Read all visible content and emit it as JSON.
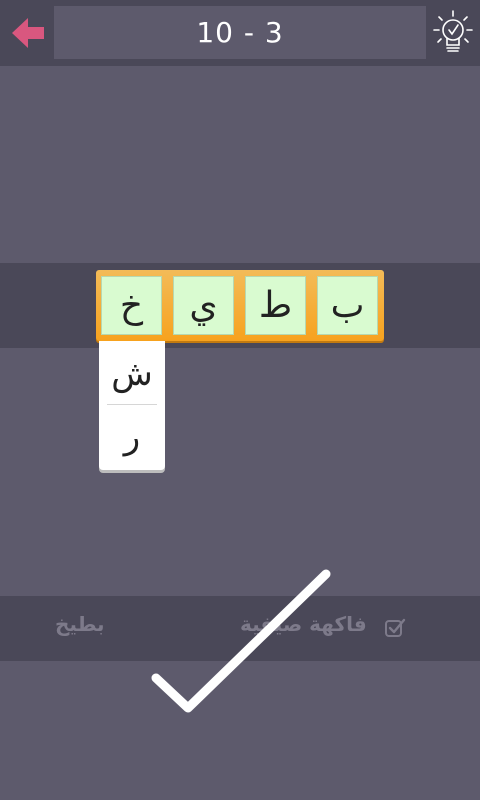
{
  "header": {
    "level_title": "10 - 3",
    "back_icon": "arrow-left-icon",
    "hint_icon": "lightbulb-check-icon"
  },
  "tiles": [
    {
      "letter": "ب"
    },
    {
      "letter": "ط"
    },
    {
      "letter": "ي"
    },
    {
      "letter": "خ"
    }
  ],
  "dropdown": {
    "options": [
      "ش",
      "ر"
    ]
  },
  "answers": {
    "category": "فاكهة صيفية",
    "category_checked": true,
    "word": "بطيخ"
  },
  "feedback": {
    "icon": "checkmark-icon"
  },
  "colors": {
    "background": "#5d5a6c",
    "band": "#4a4858",
    "tile": "#d9fbd0",
    "tile_frame": "#f7a21e",
    "back_arrow": "#d9577f"
  }
}
